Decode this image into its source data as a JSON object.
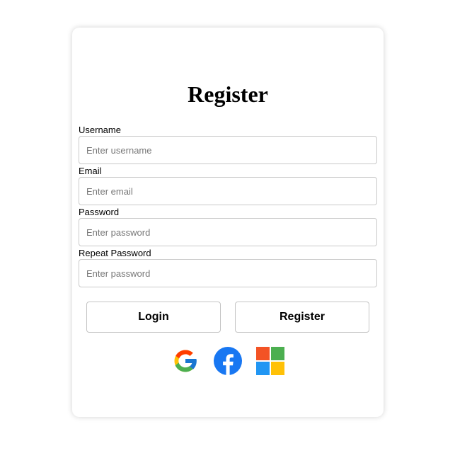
{
  "form": {
    "title": "Register",
    "fields": [
      {
        "label": "Username",
        "placeholder": "Enter username",
        "value": ""
      },
      {
        "label": "Email",
        "placeholder": "Enter email",
        "value": ""
      },
      {
        "label": "Password",
        "placeholder": "Enter password",
        "value": ""
      },
      {
        "label": "Repeat Password",
        "placeholder": "Enter password",
        "value": ""
      }
    ],
    "buttons": {
      "login_label": "Login",
      "register_label": "Register"
    },
    "social": [
      {
        "icon": "google-icon"
      },
      {
        "icon": "facebook-icon"
      },
      {
        "icon": "microsoft-icon"
      }
    ]
  },
  "colors": {
    "facebook": "#1877f2",
    "microsoft_red": "#f35325",
    "microsoft_green": "#4caf50",
    "microsoft_blue": "#2196f3",
    "microsoft_yellow": "#ffc107"
  }
}
